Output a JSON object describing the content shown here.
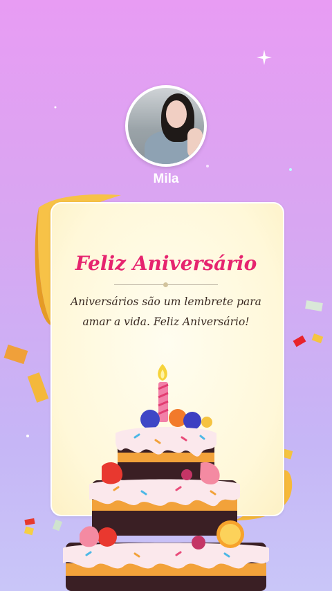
{
  "profile": {
    "name": "Mila"
  },
  "card": {
    "title": "Feliz Aniversário",
    "message": "Aniversários são um lembrete para amar a vida. Feliz Aniversário!"
  },
  "colors": {
    "background_top": "#e89cf3",
    "background_bottom": "#c9c6f8",
    "title": "#e6246f",
    "card": "#fff8d9"
  },
  "icons": [
    "sparkle-icon",
    "birthday-cake-icon",
    "candle-icon",
    "confetti-icon",
    "ribbon-icon"
  ]
}
